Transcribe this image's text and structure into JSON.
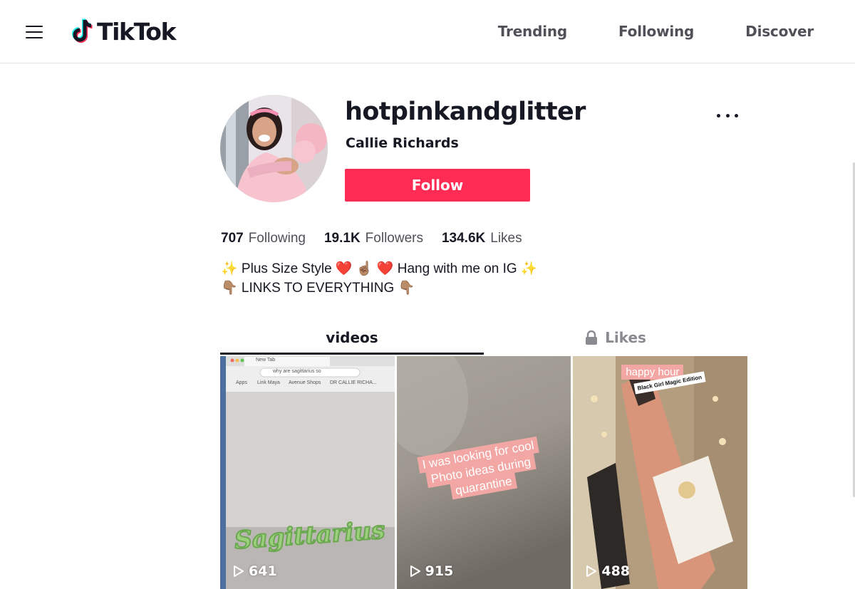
{
  "header": {
    "logo_text": "TikTok",
    "nav": [
      "Trending",
      "Following",
      "Discover"
    ]
  },
  "profile": {
    "username": "hotpinkandglitter",
    "display_name": "Callie Richards",
    "follow_label": "Follow",
    "stats": [
      {
        "value": "707",
        "label": "Following"
      },
      {
        "value": "19.1K",
        "label": "Followers"
      },
      {
        "value": "134.6K",
        "label": "Likes"
      }
    ],
    "bio_lines": [
      "✨ Plus Size Style ❤️ ☝🏽 ❤️ Hang with me on IG ✨",
      "👇🏽 LINKS TO EVERYTHING 👇🏽"
    ]
  },
  "tabs": {
    "videos_label": "videos",
    "likes_label": "Likes"
  },
  "videos": [
    {
      "views": "641",
      "overlay": "Sagittarius",
      "browser_tab": "New Tab",
      "url_bar": "why are sagittarius so",
      "bookmarks": [
        "Apps",
        "Link Maya",
        "Avenue Shops",
        "DR CALLIE RICHA..."
      ]
    },
    {
      "views": "915",
      "overlay": "I was looking for cool Photo ideas during quarantine"
    },
    {
      "views": "488",
      "overlay": "happy hour",
      "sticker": "Black Girl Magic Edition"
    }
  ],
  "colors": {
    "accent": "#fe2c55",
    "text": "#161823",
    "muted": "#505158"
  }
}
